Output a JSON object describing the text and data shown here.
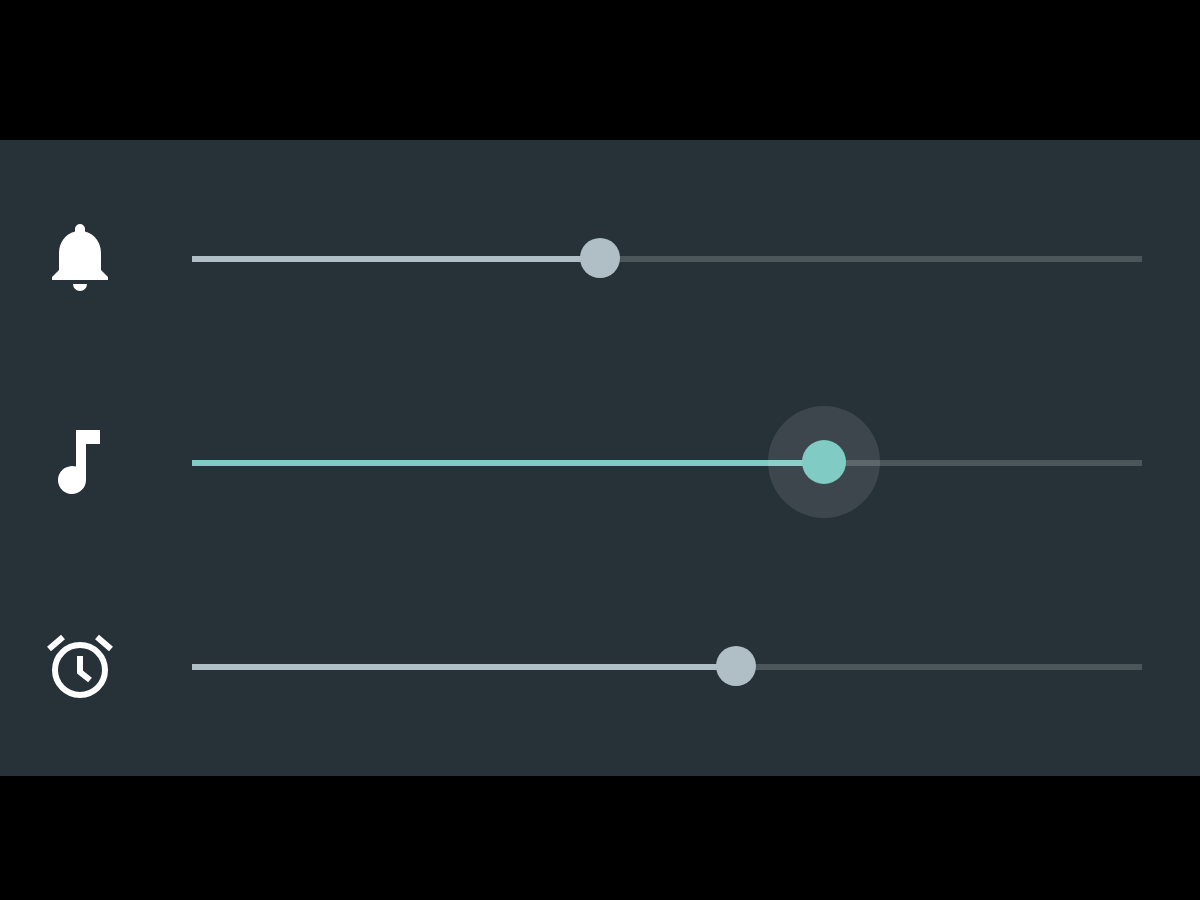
{
  "sliders": [
    {
      "kind": "ringer",
      "level": 0.43,
      "active": false
    },
    {
      "kind": "media",
      "level": 0.665,
      "active": true
    },
    {
      "kind": "alarm",
      "level": 0.573,
      "active": false
    }
  ]
}
